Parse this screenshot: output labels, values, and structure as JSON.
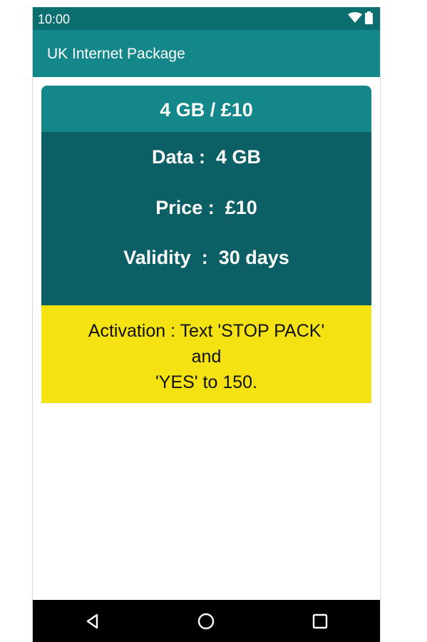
{
  "status_bar": {
    "time": "10:00",
    "icons": [
      "wifi-icon",
      "battery-icon"
    ],
    "color": "#0d6e6f"
  },
  "app_bar": {
    "title": "UK Internet Package",
    "color": "#13878a"
  },
  "package": {
    "header": "4 GB / £10",
    "data_line": "Data :  4 GB",
    "price_line": "Price :  £10",
    "validity_line": "Validity  :  30 days",
    "activation_text": "Activation : Text 'STOP PACK'\nand\n'YES' to 150.",
    "body_color": "#0d5f66",
    "activation_color": "#f4e213"
  },
  "nav_bar": {
    "buttons": [
      "back-icon",
      "home-icon",
      "recents-icon"
    ]
  }
}
